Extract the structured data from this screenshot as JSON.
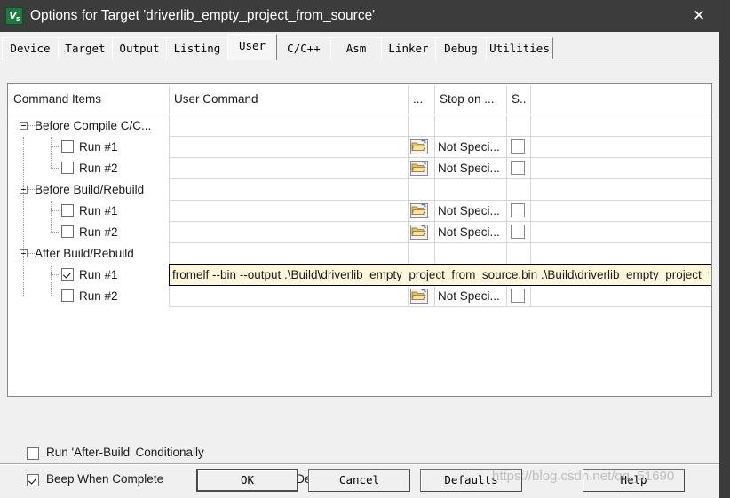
{
  "window": {
    "title": "Options for Target 'driverlib_empty_project_from_source'",
    "icon_name": "uvision-logo-icon",
    "icon_text": "V",
    "icon_sub": "5",
    "close_glyph": "✕"
  },
  "tabs": [
    {
      "label": "Device",
      "selected": false
    },
    {
      "label": "Target",
      "selected": false
    },
    {
      "label": "Output",
      "selected": false
    },
    {
      "label": "Listing",
      "selected": false
    },
    {
      "label": "User",
      "selected": true
    },
    {
      "label": "C/C++",
      "selected": false
    },
    {
      "label": "Asm",
      "selected": false
    },
    {
      "label": "Linker",
      "selected": false
    },
    {
      "label": "Debug",
      "selected": false
    },
    {
      "label": "Utilities",
      "selected": false
    }
  ],
  "grid": {
    "headers": [
      {
        "label": "Command Items"
      },
      {
        "label": "User Command"
      },
      {
        "label": "..."
      },
      {
        "label": "Stop on ..."
      },
      {
        "label": "S.."
      }
    ],
    "rows": [
      {
        "kind": "group",
        "label": "Before Compile C/C...",
        "expanded": true,
        "checked": false,
        "command": "",
        "stop_on": "",
        "s_checked": false,
        "has_cells": false
      },
      {
        "kind": "child",
        "label": "Run #1",
        "checked": false,
        "command": "",
        "stop_on": "Not Speci...",
        "s_checked": false,
        "has_cells": true
      },
      {
        "kind": "child",
        "label": "Run #2",
        "checked": false,
        "command": "",
        "stop_on": "Not Speci...",
        "s_checked": false,
        "has_cells": true
      },
      {
        "kind": "group",
        "label": "Before Build/Rebuild",
        "expanded": true,
        "checked": false,
        "command": "",
        "stop_on": "",
        "s_checked": false,
        "has_cells": false
      },
      {
        "kind": "child",
        "label": "Run #1",
        "checked": false,
        "command": "",
        "stop_on": "Not Speci...",
        "s_checked": false,
        "has_cells": true
      },
      {
        "kind": "child",
        "label": "Run #2",
        "checked": false,
        "command": "",
        "stop_on": "Not Speci...",
        "s_checked": false,
        "has_cells": true
      },
      {
        "kind": "group",
        "label": "After Build/Rebuild",
        "expanded": true,
        "checked": false,
        "command": "",
        "stop_on": "",
        "s_checked": false,
        "has_cells": false
      },
      {
        "kind": "child",
        "label": "Run #1",
        "checked": true,
        "editing": true,
        "command": "",
        "stop_on": "",
        "s_checked": false,
        "has_cells": false
      },
      {
        "kind": "child",
        "label": "Run #2",
        "checked": false,
        "command": "",
        "stop_on": "Not Speci...",
        "s_checked": false,
        "has_cells": true
      }
    ],
    "editing_value": "fromelf --bin --output .\\Build\\driverlib_empty_project_from_source.bin .\\Build\\driverlib_empty_project_from_source.axf",
    "browse_icon_name": "folder-open-icon"
  },
  "options": {
    "run_after_build_conditionally": {
      "label": "Run 'After-Build' Conditionally",
      "checked": false
    },
    "beep_when_complete": {
      "label": "Beep When Complete",
      "checked": true
    },
    "start_debugging": {
      "label": "Start Debugging",
      "checked": false
    }
  },
  "footer": {
    "ok": "OK",
    "cancel": "Cancel",
    "defaults": "Defaults",
    "help": "Help"
  },
  "watermark": "https://blog.csdn.net/qq_51690"
}
